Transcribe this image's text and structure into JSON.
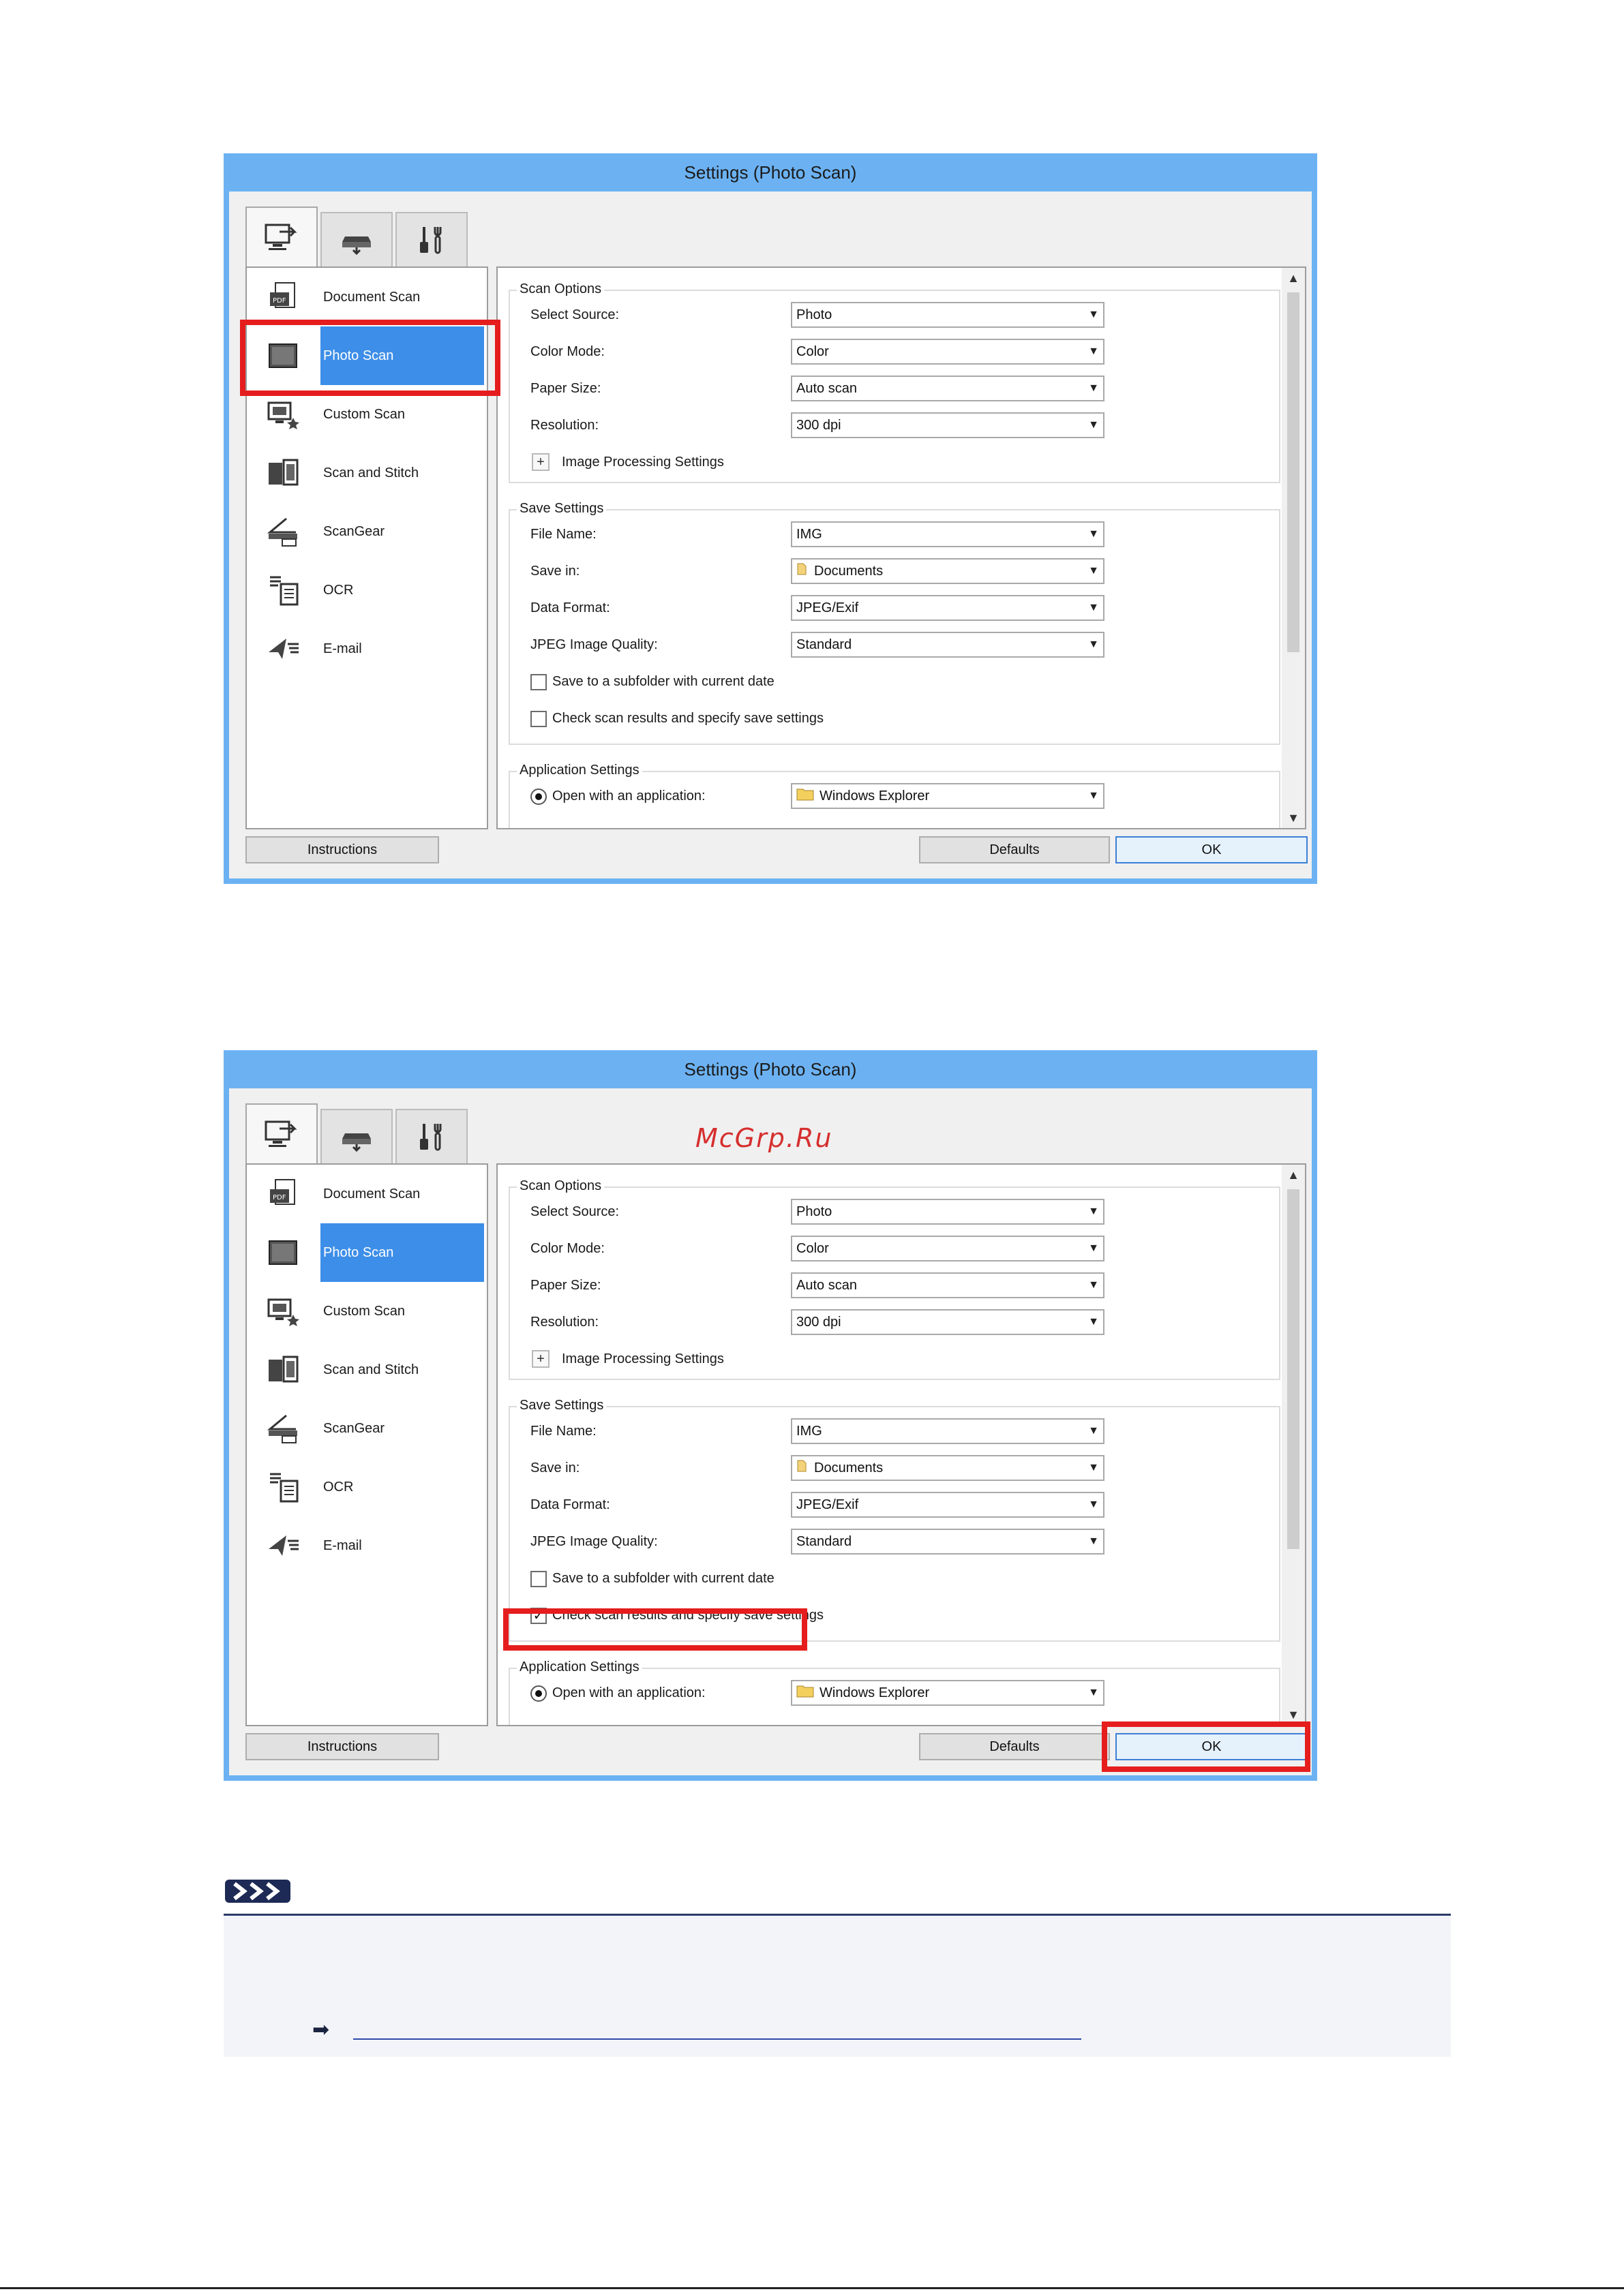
{
  "window_title": "Settings (Photo Scan)",
  "tabs": [
    {
      "name": "scan-from-computer",
      "icon": "monitor-scan-icon"
    },
    {
      "name": "scan-from-panel",
      "icon": "scanner-icon"
    },
    {
      "name": "general-settings",
      "icon": "tools-icon"
    }
  ],
  "nav_items": [
    {
      "label": "Document Scan",
      "icon": "document-scan-icon"
    },
    {
      "label": "Photo Scan",
      "icon": "photo-scan-icon",
      "selected": true
    },
    {
      "label": "Custom Scan",
      "icon": "custom-scan-icon"
    },
    {
      "label": "Scan and Stitch",
      "icon": "scan-and-stitch-icon"
    },
    {
      "label": "ScanGear",
      "icon": "scangear-icon"
    },
    {
      "label": "OCR",
      "icon": "ocr-icon"
    },
    {
      "label": "E-mail",
      "icon": "email-icon"
    }
  ],
  "scan_options": {
    "title": "Scan Options",
    "select_source_label": "Select Source:",
    "select_source_value": "Photo",
    "color_mode_label": "Color Mode:",
    "color_mode_value": "Color",
    "paper_size_label": "Paper Size:",
    "paper_size_value": "Auto scan",
    "resolution_label": "Resolution:",
    "resolution_value": "300 dpi",
    "image_processing_label": "Image Processing Settings",
    "expander_symbol": "+"
  },
  "save_settings": {
    "title": "Save Settings",
    "file_name_label": "File Name:",
    "file_name_value": "IMG",
    "save_in_label": "Save in:",
    "save_in_value": "Documents",
    "data_format_label": "Data Format:",
    "data_format_value": "JPEG/Exif",
    "jpeg_quality_label": "JPEG Image Quality:",
    "jpeg_quality_value": "Standard",
    "subfolder_label": "Save to a subfolder with current date",
    "check_results_label": "Check scan results and specify save settings"
  },
  "application_settings": {
    "title": "Application Settings",
    "open_with_label": "Open with an application:",
    "open_with_value": "Windows Explorer"
  },
  "buttons": {
    "instructions": "Instructions",
    "defaults": "Defaults",
    "ok": "OK"
  },
  "screens": [
    {
      "check_results_checked": false,
      "highlight": [
        "photo-scan-item"
      ]
    },
    {
      "check_results_checked": true,
      "highlight": [
        "check-results-checkbox",
        "ok-button"
      ]
    }
  ],
  "watermark": "McGrp.Ru",
  "colors": {
    "titlebar": "#6cb2f3",
    "selection": "#3d8ee8",
    "highlight": "#e51d1d"
  }
}
